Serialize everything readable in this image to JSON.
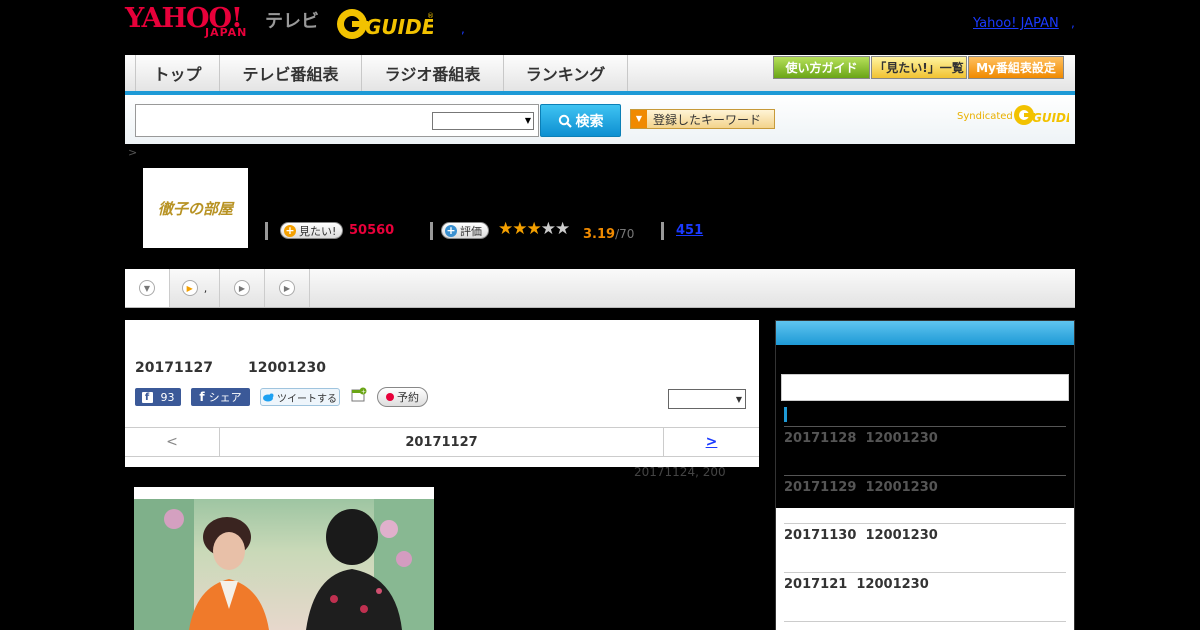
{
  "header": {
    "yahoo_logo": "YAHOO!",
    "yahoo_japan": "JAPAN",
    "tv_label": "テレビ",
    "gguide_logo": "G-GUIDE",
    "dot": ",",
    "yahoo_japan_link": "Yahoo! JAPAN",
    "link_dot": ","
  },
  "nav": {
    "tabs": [
      {
        "label": "トップ"
      },
      {
        "label": "テレビ番組表"
      },
      {
        "label": "ラジオ番組表"
      },
      {
        "label": "ランキング"
      }
    ],
    "guide_button": "使い方ガイド",
    "mitai_list_button": "「見たい!」一覧",
    "my_schedule_button": "My番組表設定"
  },
  "search": {
    "button_label": "検索",
    "keyword_button": "登録したキーワード",
    "syndicated_label": "Syndicated"
  },
  "breadcrumb": ">",
  "program": {
    "thumb_title": "徹子の部屋",
    "mitai_label": "見たい!",
    "mitai_count": "50560",
    "rate_label": "評価",
    "rating": 3.19,
    "rating_text": "3.19",
    "rating_max_text": "/70",
    "comment_count": "451"
  },
  "subtabs": {
    "second_label": ","
  },
  "episode": {
    "date": "20171127",
    "time": "12001230",
    "fb_count": "93",
    "fb_share": "シェア",
    "tweet_label": "ツイートする",
    "reserve_label": "予約",
    "pager_prev": "<",
    "pager_date": "20171127",
    "pager_next": ">",
    "updated": "20171124, 200"
  },
  "sidebar": {
    "items": [
      {
        "date": "20171128",
        "time": "12001230"
      },
      {
        "date": "20171129",
        "time": "12001230"
      },
      {
        "date": "20171130",
        "time": "12001230"
      },
      {
        "date": "2017121",
        "time": "12001230"
      }
    ]
  },
  "colors": {
    "yahoo_red": "#e8003a",
    "accent_blue": "#1e9ad6",
    "gguide_yellow": "#f2c200",
    "star_orange": "#f4a000"
  }
}
